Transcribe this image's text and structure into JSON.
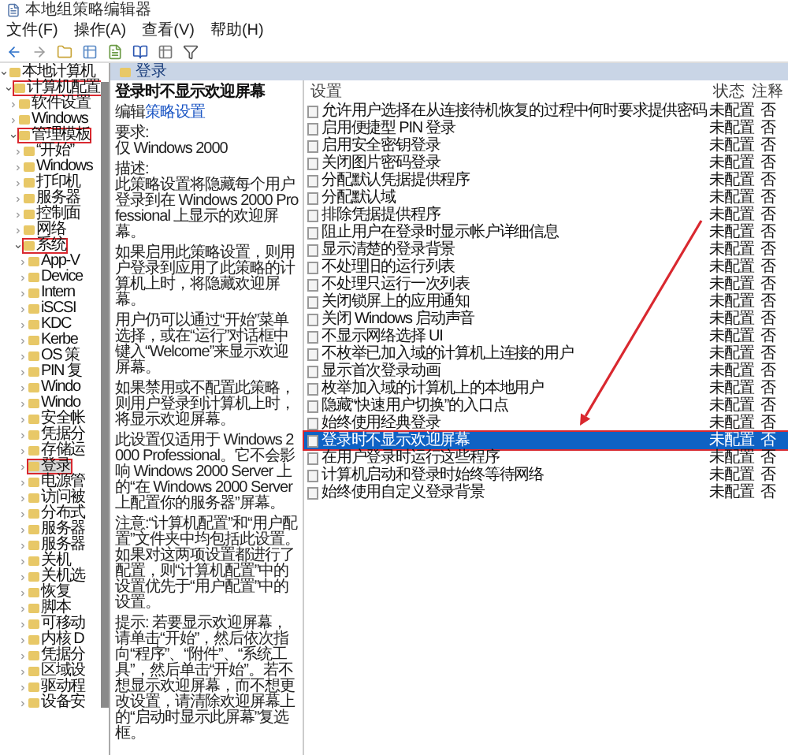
{
  "window": {
    "title": "本地组策略编辑器"
  },
  "menu": [
    "文件(F)",
    "操作(A)",
    "查看(V)",
    "帮助(H)"
  ],
  "tree": [
    {
      "label": "本地计算机",
      "expanded": true,
      "selected": false,
      "highlighted": false,
      "children": [
        {
          "label": "计算机配置",
          "expanded": true,
          "selected": false,
          "highlighted": true,
          "children": [
            {
              "label": "软件设置",
              "expanded": false,
              "selected": false,
              "highlighted": false
            },
            {
              "label": "Windows",
              "expanded": false,
              "selected": false,
              "highlighted": false
            },
            {
              "label": "管理模板",
              "expanded": true,
              "selected": false,
              "highlighted": true,
              "children": [
                {
                  "label": "“开始”",
                  "expanded": false,
                  "selected": false,
                  "highlighted": false
                },
                {
                  "label": "Windows",
                  "expanded": false,
                  "selected": false,
                  "highlighted": false
                },
                {
                  "label": "打印机",
                  "expanded": false,
                  "selected": false,
                  "highlighted": false
                },
                {
                  "label": "服务器",
                  "expanded": false,
                  "selected": false,
                  "highlighted": false
                },
                {
                  "label": "控制面",
                  "expanded": false,
                  "selected": false,
                  "highlighted": false
                },
                {
                  "label": "网络",
                  "expanded": false,
                  "selected": false,
                  "highlighted": false
                },
                {
                  "label": "系统",
                  "expanded": true,
                  "selected": false,
                  "highlighted": true,
                  "children": [
                    {
                      "label": "App-V",
                      "expanded": false,
                      "selected": false,
                      "highlighted": false
                    },
                    {
                      "label": "Device",
                      "expanded": false,
                      "selected": false,
                      "highlighted": false
                    },
                    {
                      "label": "Intern",
                      "expanded": false,
                      "selected": false,
                      "highlighted": false
                    },
                    {
                      "label": "iSCSI",
                      "expanded": false,
                      "selected": false,
                      "highlighted": false
                    },
                    {
                      "label": "KDC",
                      "expanded": false,
                      "selected": false,
                      "highlighted": false
                    },
                    {
                      "label": "Kerbe",
                      "expanded": false,
                      "selected": false,
                      "highlighted": false
                    },
                    {
                      "label": "OS 策",
                      "expanded": false,
                      "selected": false,
                      "highlighted": false
                    },
                    {
                      "label": "PIN 复",
                      "expanded": false,
                      "selected": false,
                      "highlighted": false
                    },
                    {
                      "label": "Windo",
                      "expanded": false,
                      "selected": false,
                      "highlighted": false
                    },
                    {
                      "label": "Windo",
                      "expanded": false,
                      "selected": false,
                      "highlighted": false
                    },
                    {
                      "label": "安全帐",
                      "expanded": false,
                      "selected": false,
                      "highlighted": false
                    },
                    {
                      "label": "凭据分",
                      "expanded": false,
                      "selected": false,
                      "highlighted": false
                    },
                    {
                      "label": "存储运",
                      "expanded": false,
                      "selected": false,
                      "highlighted": false
                    },
                    {
                      "label": "登录",
                      "expanded": false,
                      "selected": true,
                      "highlighted": true
                    },
                    {
                      "label": "电源管",
                      "expanded": false,
                      "selected": false,
                      "highlighted": false
                    },
                    {
                      "label": "访问被",
                      "expanded": false,
                      "selected": false,
                      "highlighted": false
                    },
                    {
                      "label": "分布式",
                      "expanded": false,
                      "selected": false,
                      "highlighted": false
                    },
                    {
                      "label": "服务器",
                      "expanded": false,
                      "selected": false,
                      "highlighted": false
                    },
                    {
                      "label": "服务器",
                      "expanded": false,
                      "selected": false,
                      "highlighted": false
                    },
                    {
                      "label": "关机",
                      "expanded": false,
                      "selected": false,
                      "highlighted": false
                    },
                    {
                      "label": "关机选",
                      "expanded": false,
                      "selected": false,
                      "highlighted": false
                    },
                    {
                      "label": "恢复",
                      "expanded": false,
                      "selected": false,
                      "highlighted": false
                    },
                    {
                      "label": "脚本",
                      "expanded": false,
                      "selected": false,
                      "highlighted": false
                    },
                    {
                      "label": "可移动",
                      "expanded": false,
                      "selected": false,
                      "highlighted": false
                    },
                    {
                      "label": "内核 D",
                      "expanded": false,
                      "selected": false,
                      "highlighted": false
                    },
                    {
                      "label": "凭据分",
                      "expanded": false,
                      "selected": false,
                      "highlighted": false
                    },
                    {
                      "label": "区域设",
                      "expanded": false,
                      "selected": false,
                      "highlighted": false
                    },
                    {
                      "label": "驱动程",
                      "expanded": false,
                      "selected": false,
                      "highlighted": false
                    },
                    {
                      "label": "设备安",
                      "expanded": false,
                      "selected": false,
                      "highlighted": false
                    }
                  ]
                }
              ]
            }
          ]
        }
      ]
    }
  ],
  "details": {
    "header": "登录",
    "title": "登录时不显示欢迎屏幕",
    "edit_prefix": "编辑",
    "edit_link": "策略设置",
    "requirement_label": "要求:",
    "requirement": "仅 Windows 2000",
    "description_label": "描述:",
    "paragraphs": [
      "此策略设置将隐藏每个用户登录到在 Windows 2000 Professional 上显示的欢迎屏幕。",
      "如果启用此策略设置，则用户登录到应用了此策略的计算机上时，将隐藏欢迎屏幕。",
      "用户仍可以通过“开始”菜单选择，或在“运行”对话框中键入“Welcome”来显示欢迎屏幕。",
      "如果禁用或不配置此策略，则用户登录到计算机上时，将显示欢迎屏幕。",
      "此设置仅适用于 Windows 2000 Professional。它不会影响 Windows 2000 Server 上的“在 Windows 2000 Server 上配置你的服务器”屏幕。",
      "注意:“计算机配置”和“用户配置”文件夹中均包括此设置。如果对这两项设置都进行了配置，则“计算机配置”中的设置优先于“用户配置”中的设置。",
      "提示: 若要显示欢迎屏幕，请单击“开始”，然后依次指向“程序”、“附件”、“系统工具”，然后单击“开始”。若不想显示欢迎屏幕，而不想更改设置，请清除欢迎屏幕上的“启动时显示此屏幕”复选框。"
    ]
  },
  "list": {
    "columns": [
      "设置",
      "状态",
      "注释"
    ],
    "rows": [
      {
        "setting": "允许用户选择在从连接待机恢复的过程中何时要求提供密码",
        "state": "未配置",
        "comment": "否",
        "selected": false,
        "highlighted": false
      },
      {
        "setting": "启用便捷型 PIN 登录",
        "state": "未配置",
        "comment": "否",
        "selected": false,
        "highlighted": false
      },
      {
        "setting": "启用安全密钥登录",
        "state": "未配置",
        "comment": "否",
        "selected": false,
        "highlighted": false
      },
      {
        "setting": "关闭图片密码登录",
        "state": "未配置",
        "comment": "否",
        "selected": false,
        "highlighted": false
      },
      {
        "setting": "分配默认凭据提供程序",
        "state": "未配置",
        "comment": "否",
        "selected": false,
        "highlighted": false
      },
      {
        "setting": "分配默认域",
        "state": "未配置",
        "comment": "否",
        "selected": false,
        "highlighted": false
      },
      {
        "setting": "排除凭据提供程序",
        "state": "未配置",
        "comment": "否",
        "selected": false,
        "highlighted": false
      },
      {
        "setting": "阻止用户在登录时显示帐户详细信息",
        "state": "未配置",
        "comment": "否",
        "selected": false,
        "highlighted": false
      },
      {
        "setting": "显示清楚的登录背景",
        "state": "未配置",
        "comment": "否",
        "selected": false,
        "highlighted": false
      },
      {
        "setting": "不处理旧的运行列表",
        "state": "未配置",
        "comment": "否",
        "selected": false,
        "highlighted": false
      },
      {
        "setting": "不处理只运行一次列表",
        "state": "未配置",
        "comment": "否",
        "selected": false,
        "highlighted": false
      },
      {
        "setting": "关闭锁屏上的应用通知",
        "state": "未配置",
        "comment": "否",
        "selected": false,
        "highlighted": false
      },
      {
        "setting": "关闭 Windows 启动声音",
        "state": "未配置",
        "comment": "否",
        "selected": false,
        "highlighted": false
      },
      {
        "setting": "不显示网络选择 UI",
        "state": "未配置",
        "comment": "否",
        "selected": false,
        "highlighted": false
      },
      {
        "setting": "不枚举已加入域的计算机上连接的用户",
        "state": "未配置",
        "comment": "否",
        "selected": false,
        "highlighted": false
      },
      {
        "setting": "显示首次登录动画",
        "state": "未配置",
        "comment": "否",
        "selected": false,
        "highlighted": false
      },
      {
        "setting": "枚举加入域的计算机上的本地用户",
        "state": "未配置",
        "comment": "否",
        "selected": false,
        "highlighted": false
      },
      {
        "setting": "隐藏“快速用户切换”的入口点",
        "state": "未配置",
        "comment": "否",
        "selected": false,
        "highlighted": false
      },
      {
        "setting": "始终使用经典登录",
        "state": "未配置",
        "comment": "否",
        "selected": false,
        "highlighted": false
      },
      {
        "setting": "登录时不显示欢迎屏幕",
        "state": "未配置",
        "comment": "否",
        "selected": true,
        "highlighted": true
      },
      {
        "setting": "在用户登录时运行这些程序",
        "state": "未配置",
        "comment": "否",
        "selected": false,
        "highlighted": false
      },
      {
        "setting": "计算机启动和登录时始终等待网络",
        "state": "未配置",
        "comment": "否",
        "selected": false,
        "highlighted": false
      },
      {
        "setting": "始终使用自定义登录背景",
        "state": "未配置",
        "comment": "否",
        "selected": false,
        "highlighted": false
      }
    ]
  }
}
